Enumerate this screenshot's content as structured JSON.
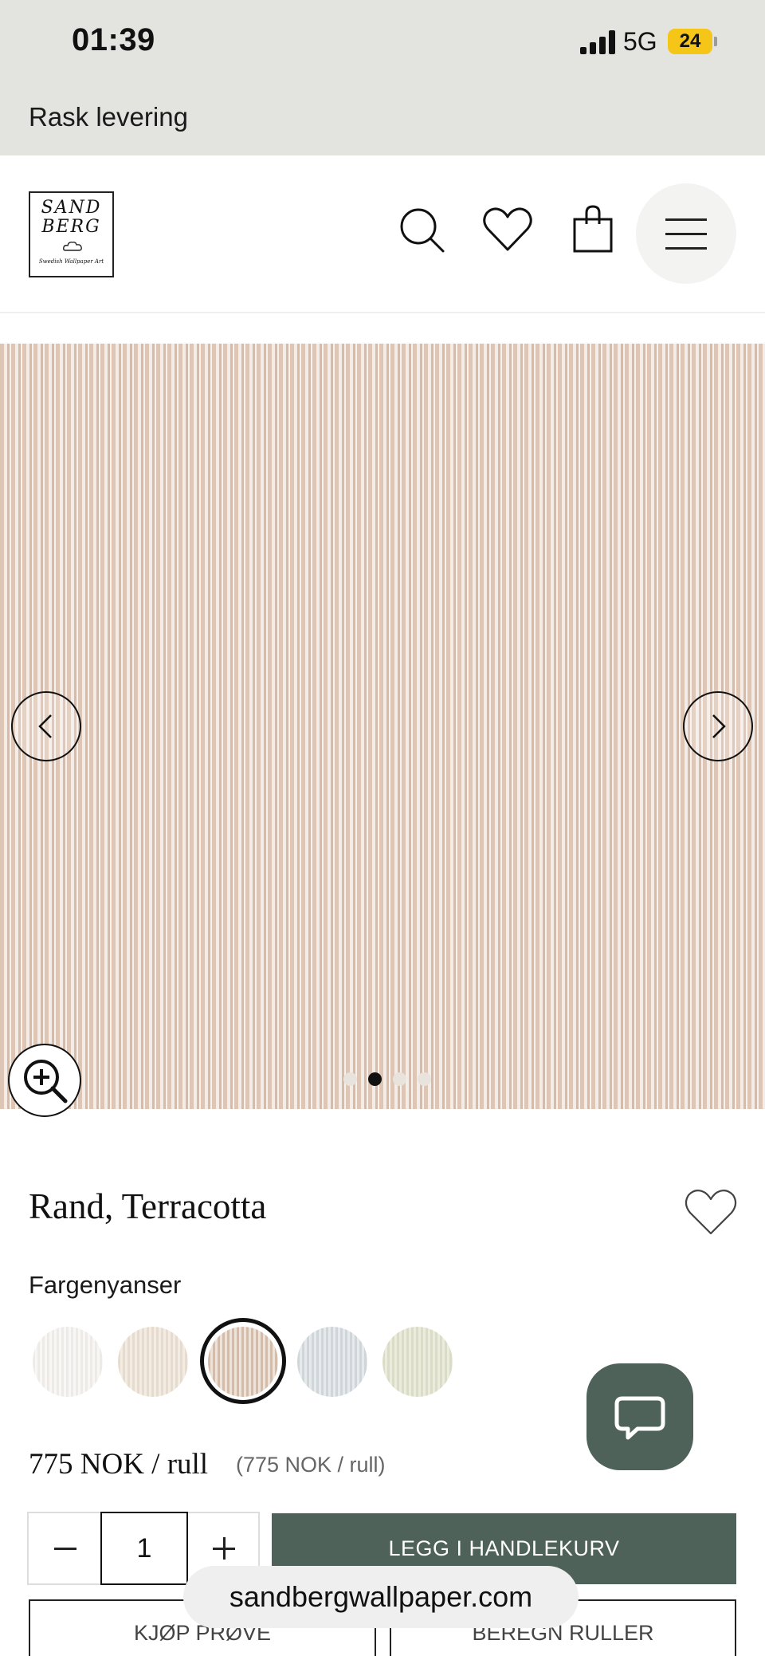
{
  "status_bar": {
    "time": "01:39",
    "network": "5G",
    "battery": "24"
  },
  "banner": {
    "text": "Rask levering"
  },
  "logo": {
    "line1": "SAND",
    "line2": "BERG",
    "tagline": "Swedish Wallpaper Art"
  },
  "header": {
    "icons": [
      "search-icon",
      "heart-icon",
      "bag-icon",
      "menu-icon"
    ]
  },
  "gallery": {
    "slide_count": 4,
    "active_slide": 2,
    "colors": {
      "stripe_dark": "#ddc6b5",
      "stripe_light": "#f4ece6"
    }
  },
  "product": {
    "title": "Rand, Terracotta",
    "swatch_label": "Fargenyanser",
    "swatches": [
      "#f3f1ee",
      "#ece3d9",
      "#dcc6b4",
      "#d9dee0",
      "#e3e5d6"
    ],
    "selected_swatch": 3,
    "price": "775 NOK / rull",
    "unit_price": "(775 NOK / rull)"
  },
  "purchase": {
    "quantity": "1",
    "add_to_cart": "LEGG I HANDLEKURV",
    "buy_sample": "KJØP PRØVE",
    "calculate_rolls": "BEREGN RULLER"
  },
  "browser": {
    "url": "sandbergwallpaper.com"
  },
  "colors": {
    "accent": "#4e6259",
    "status_bg": "#e3e3e0"
  }
}
